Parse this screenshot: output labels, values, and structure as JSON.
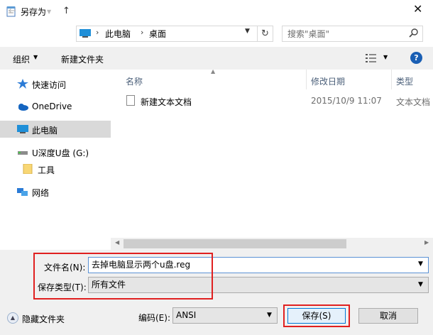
{
  "window": {
    "title": "另存为"
  },
  "address": {
    "crumbs": [
      "此电脑",
      "桌面"
    ],
    "search_placeholder": "搜索\"桌面\""
  },
  "toolbar": {
    "organize": "组织",
    "new_folder": "新建文件夹"
  },
  "nav": {
    "items": [
      {
        "label": "快速访问",
        "icon": "star-icon"
      },
      {
        "label": "OneDrive",
        "icon": "cloud-icon"
      },
      {
        "label": "此电脑",
        "icon": "computer-icon"
      },
      {
        "label": "U深度U盘 (G:)",
        "icon": "usb-drive-icon"
      },
      {
        "label": "工具",
        "icon": "folder-icon"
      },
      {
        "label": "网络",
        "icon": "network-icon"
      }
    ]
  },
  "list": {
    "columns": [
      "名称",
      "修改日期",
      "类型"
    ],
    "rows": [
      {
        "name": "新建文本文档",
        "date": "2015/10/9 11:07",
        "type": "文本文档"
      }
    ]
  },
  "form": {
    "filename_label": "文件名(N):",
    "filename_value": "去掉电脑显示两个u盘.reg",
    "filetype_label": "保存类型(T):",
    "filetype_value": "所有文件",
    "hide_folders": "隐藏文件夹",
    "encoding_label": "编码(E):",
    "encoding_value": "ANSI",
    "save": "保存(S)",
    "cancel": "取消"
  },
  "colors": {
    "accent": "#0078d7",
    "highlight": "#e02020",
    "selected": "#d9d9d9"
  }
}
